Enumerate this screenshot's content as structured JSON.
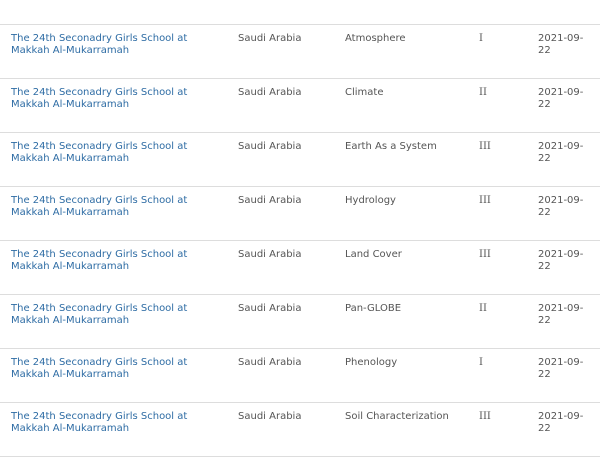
{
  "rows": [
    {
      "school": "The 24th Seconadry Girls School at Makkah Al-Mukarramah",
      "country": "Saudi Arabia",
      "protocol": "Atmosphere",
      "level": "I",
      "date": "2021-09-22"
    },
    {
      "school": "The 24th Seconadry Girls School at Makkah Al-Mukarramah",
      "country": "Saudi Arabia",
      "protocol": "Climate",
      "level": "II",
      "date": "2021-09-22"
    },
    {
      "school": "The 24th Seconadry Girls School at Makkah Al-Mukarramah",
      "country": "Saudi Arabia",
      "protocol": "Earth As a System",
      "level": "III",
      "date": "2021-09-22"
    },
    {
      "school": "The 24th Seconadry Girls School at Makkah Al-Mukarramah",
      "country": "Saudi Arabia",
      "protocol": "Hydrology",
      "level": "III",
      "date": "2021-09-22"
    },
    {
      "school": "The 24th Seconadry Girls School at Makkah Al-Mukarramah",
      "country": "Saudi Arabia",
      "protocol": "Land Cover",
      "level": "III",
      "date": "2021-09-22"
    },
    {
      "school": "The 24th Seconadry Girls School at Makkah Al-Mukarramah",
      "country": "Saudi Arabia",
      "protocol": "Pan-GLOBE",
      "level": "II",
      "date": "2021-09-22"
    },
    {
      "school": "The 24th Seconadry Girls School at Makkah Al-Mukarramah",
      "country": "Saudi Arabia",
      "protocol": "Phenology",
      "level": "I",
      "date": "2021-09-22"
    },
    {
      "school": "The 24th Seconadry Girls School at Makkah Al-Mukarramah",
      "country": "Saudi Arabia",
      "protocol": "Soil Characterization",
      "level": "III",
      "date": "2021-09-22"
    }
  ]
}
